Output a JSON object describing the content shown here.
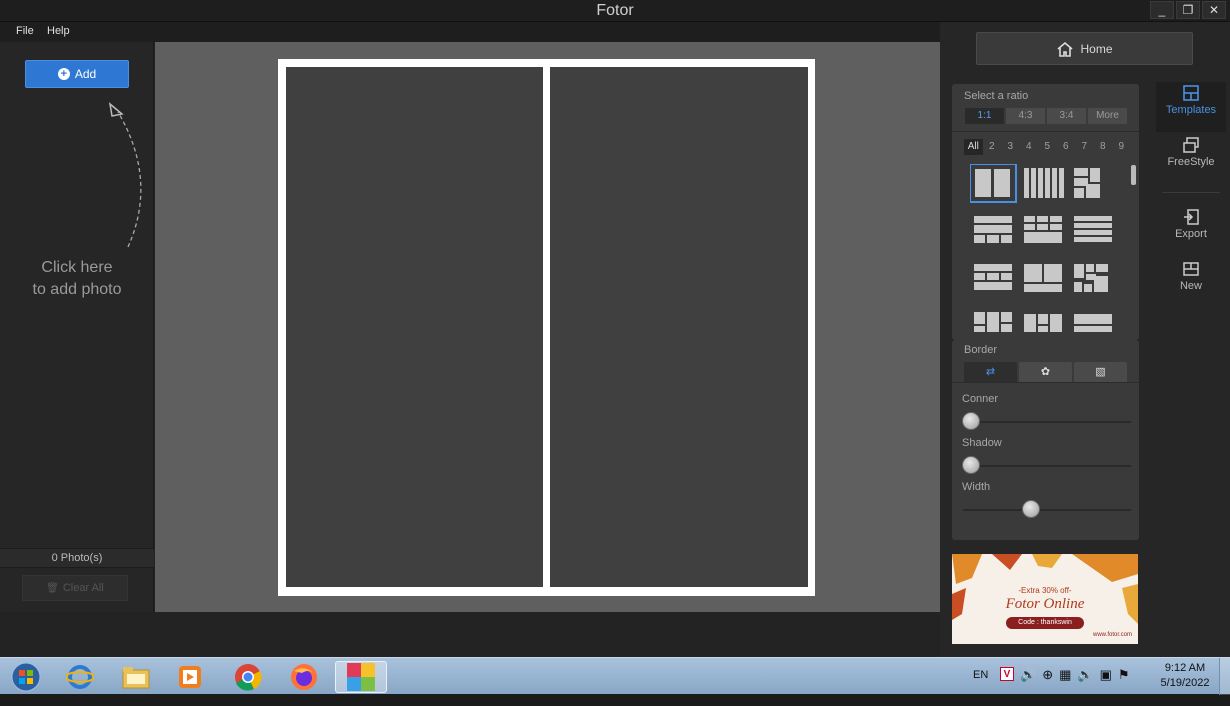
{
  "window": {
    "title": "Fotor",
    "controls": [
      "_",
      "❐",
      "✕"
    ]
  },
  "menu": {
    "file": "File",
    "help": "Help"
  },
  "left": {
    "add_label": "Add",
    "hint_line1": "Click here",
    "hint_line2": "to add photo",
    "photo_count": "0 Photo(s)",
    "clear_all": "Clear All"
  },
  "right": {
    "home_label": "Home",
    "ratio_title": "Select a ratio",
    "ratios": [
      "1:1",
      "4:3",
      "3:4",
      "More"
    ],
    "selected_ratio": "1:1",
    "counts": [
      "All",
      "2",
      "3",
      "4",
      "5",
      "6",
      "7",
      "8",
      "9"
    ],
    "selected_count": "All",
    "border_title": "Border",
    "sliders": [
      {
        "label": "Conner",
        "value": 0
      },
      {
        "label": "Shadow",
        "value": 0
      },
      {
        "label": "Width",
        "value": 0.4
      }
    ],
    "ad": {
      "line1": "-Extra 30% off-",
      "line2": "Fotor Online",
      "line3": "Code : thankswin",
      "line4": "www.fotor.com"
    }
  },
  "sidebar": {
    "templates": "Templates",
    "freestyle": "FreeStyle",
    "export": "Export",
    "new": "New"
  },
  "taskbar": {
    "lang": "EN",
    "time": "9:12 AM",
    "date": "5/19/2022"
  },
  "colors": {
    "accent": "#2e78d4",
    "selected": "#4a90e2"
  }
}
